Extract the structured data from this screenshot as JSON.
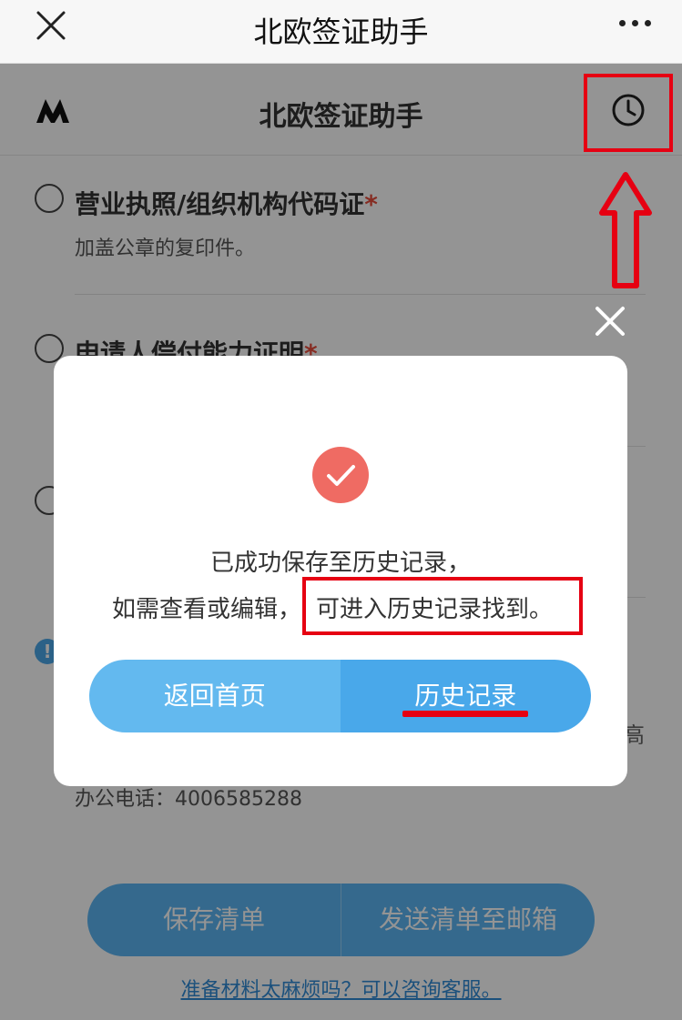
{
  "topbar": {
    "title": "北欧签证助手"
  },
  "appbar": {
    "title": "北欧签证助手"
  },
  "checklist": {
    "item1": {
      "title": "营业执照/组织机构代码证",
      "required": "*",
      "desc": "加盖公章的复印件。"
    },
    "item2": {
      "title": "申请人偿付能力证明",
      "required": "*"
    }
  },
  "info": {
    "icon": "!",
    "fragment": "高",
    "phone": "办公电话：4006585288"
  },
  "bottom": {
    "save": "保存清单",
    "send": "发送清单至邮箱",
    "consult": "准备材料太麻烦吗？可以咨询客服。"
  },
  "modal": {
    "line1": "已成功保存至历史记录，",
    "line2_prefix": "如需查看或编辑，",
    "line2_highlight": "可进入历史记录找到。",
    "btn_home": "返回首页",
    "btn_history": "历史记录"
  },
  "colors": {
    "accent": "#49a8ea",
    "success": "#ef6b63",
    "annotation": "#e60012"
  }
}
